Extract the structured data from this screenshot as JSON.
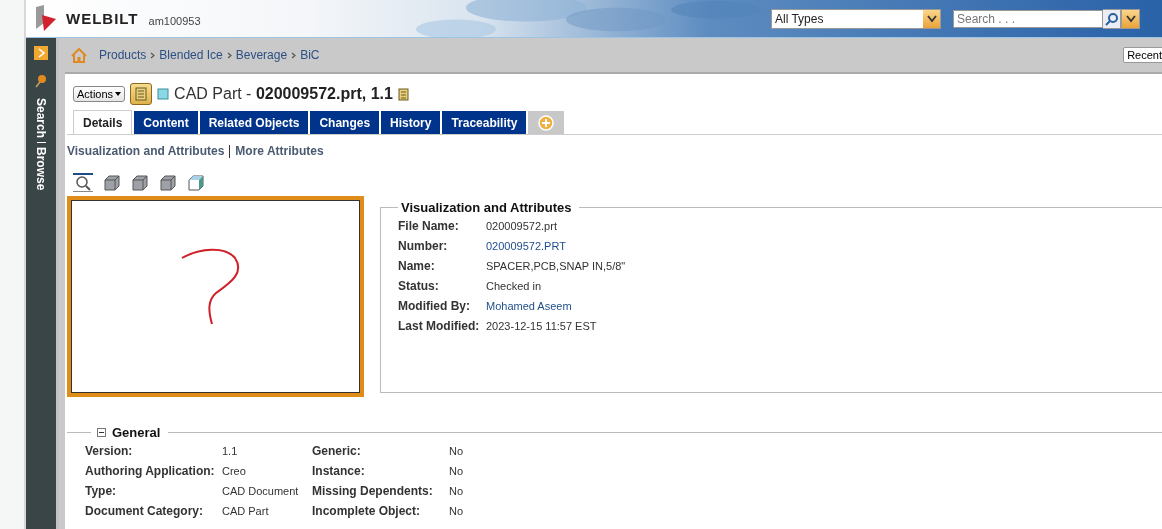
{
  "header": {
    "brand": "WELBILT",
    "user": "am100953",
    "type_select": {
      "value": "All Types"
    },
    "search": {
      "placeholder": "Search . . ."
    }
  },
  "sidebar": {
    "items": [
      {
        "label": "Search"
      },
      {
        "label": "Browse"
      }
    ]
  },
  "breadcrumb": [
    "Products",
    "Blended Ice",
    "Beverage",
    "BiC"
  ],
  "recent_button": "Recent",
  "title": {
    "actions": "Actions",
    "prefix": "CAD Part - ",
    "name": "020009572.prt, 1.1"
  },
  "tabs": [
    {
      "label": "Details",
      "selected": true
    },
    {
      "label": "Content",
      "selected": false
    },
    {
      "label": "Related Objects",
      "selected": false
    },
    {
      "label": "Changes",
      "selected": false
    },
    {
      "label": "History",
      "selected": false
    },
    {
      "label": "Traceability",
      "selected": false
    }
  ],
  "subnav": [
    "Visualization and Attributes",
    "More Attributes"
  ],
  "attributes": {
    "title": "Visualization and Attributes",
    "rows": [
      {
        "label": "File Name:",
        "value": "020009572.prt",
        "link": false
      },
      {
        "label": "Number:",
        "value": "020009572.PRT",
        "link": true
      },
      {
        "label": "Name:",
        "value": "SPACER,PCB,SNAP IN,5/8\"",
        "link": false
      },
      {
        "label": "Status:",
        "value": "Checked in",
        "link": false
      },
      {
        "label": "Modified By:",
        "value": "Mohamed Aseem",
        "link": true
      },
      {
        "label": "Last Modified:",
        "value": "2023-12-15 11:57 EST",
        "link": false
      }
    ]
  },
  "general": {
    "title": "General",
    "expanded": true,
    "columns": [
      [
        {
          "label": "Version:",
          "value": "1.1"
        },
        {
          "label": "Authoring Application:",
          "value": "Creo"
        },
        {
          "label": "Type:",
          "value": "CAD Document"
        },
        {
          "label": "Document Category:",
          "value": "CAD Part"
        }
      ],
      [
        {
          "label": "Generic:",
          "value": "No"
        },
        {
          "label": "Instance:",
          "value": "No"
        },
        {
          "label": "Missing Dependents:",
          "value": "No"
        },
        {
          "label": "Incomplete Object:",
          "value": "No"
        }
      ]
    ]
  }
}
